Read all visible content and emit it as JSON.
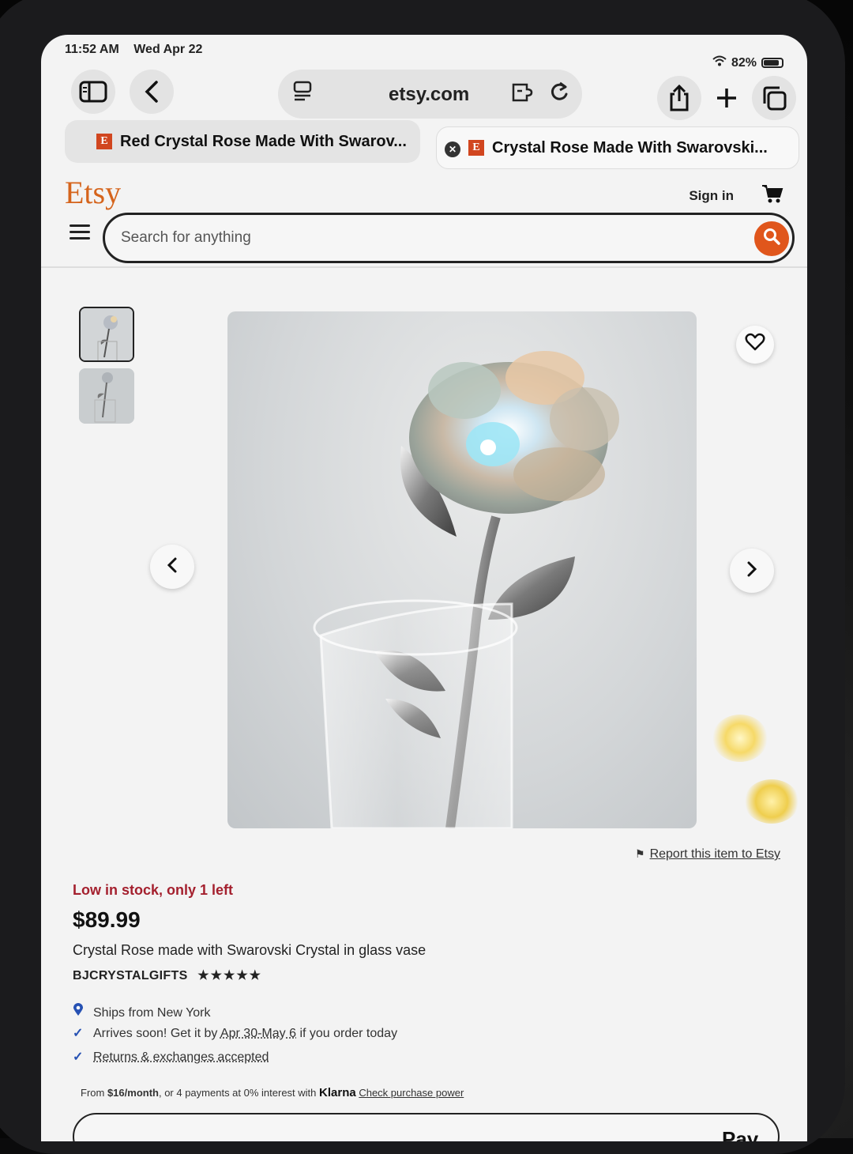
{
  "status": {
    "time": "11:52 AM",
    "date": "Wed Apr 22",
    "battery": "82%"
  },
  "browser": {
    "url": "etsy.com",
    "tabs": [
      {
        "title": "Red Crystal Rose Made With Swarov...",
        "active": false
      },
      {
        "title": "Crystal Rose Made With Swarovski...",
        "active": true
      }
    ],
    "favicon_letter": "E"
  },
  "header": {
    "logo": "Etsy",
    "sign_in": "Sign in",
    "search_placeholder": "Search for anything",
    "accent_color": "#e0561c"
  },
  "listing": {
    "report_link": "Report this item to Etsy",
    "stock_notice": "Low in stock, only 1 left",
    "price": "$89.99",
    "title": "Crystal Rose made with Swarovski Crystal in glass vase",
    "shop_name": "BJCRYSTALGIFTS",
    "rating_stars": "★★★★★",
    "rating_value": 5,
    "features": {
      "ships_from": "Ships from New York",
      "arrives_prefix": "Arrives soon! Get it by ",
      "arrives_dates": "Apr 30-May 6",
      "arrives_suffix": " if you order today",
      "returns": "Returns & exchanges accepted"
    },
    "klarna": {
      "from": "From ",
      "amount": "$16/month",
      "middle": ", or 4 payments at 0% interest with ",
      "brand": "Klarna",
      "link": "Check purchase power"
    },
    "apple_pay_label": " Pay"
  },
  "icons": [
    "sidebar-icon",
    "back-icon",
    "reader-icon",
    "extension-icon",
    "reload-icon",
    "share-icon",
    "plus-icon",
    "tabs-icon",
    "close-icon",
    "cart-icon",
    "menu-icon",
    "search-icon",
    "heart-icon",
    "chevron-left-icon",
    "chevron-right-icon",
    "flag-icon",
    "location-pin-icon",
    "check-icon",
    "apple-icon"
  ]
}
